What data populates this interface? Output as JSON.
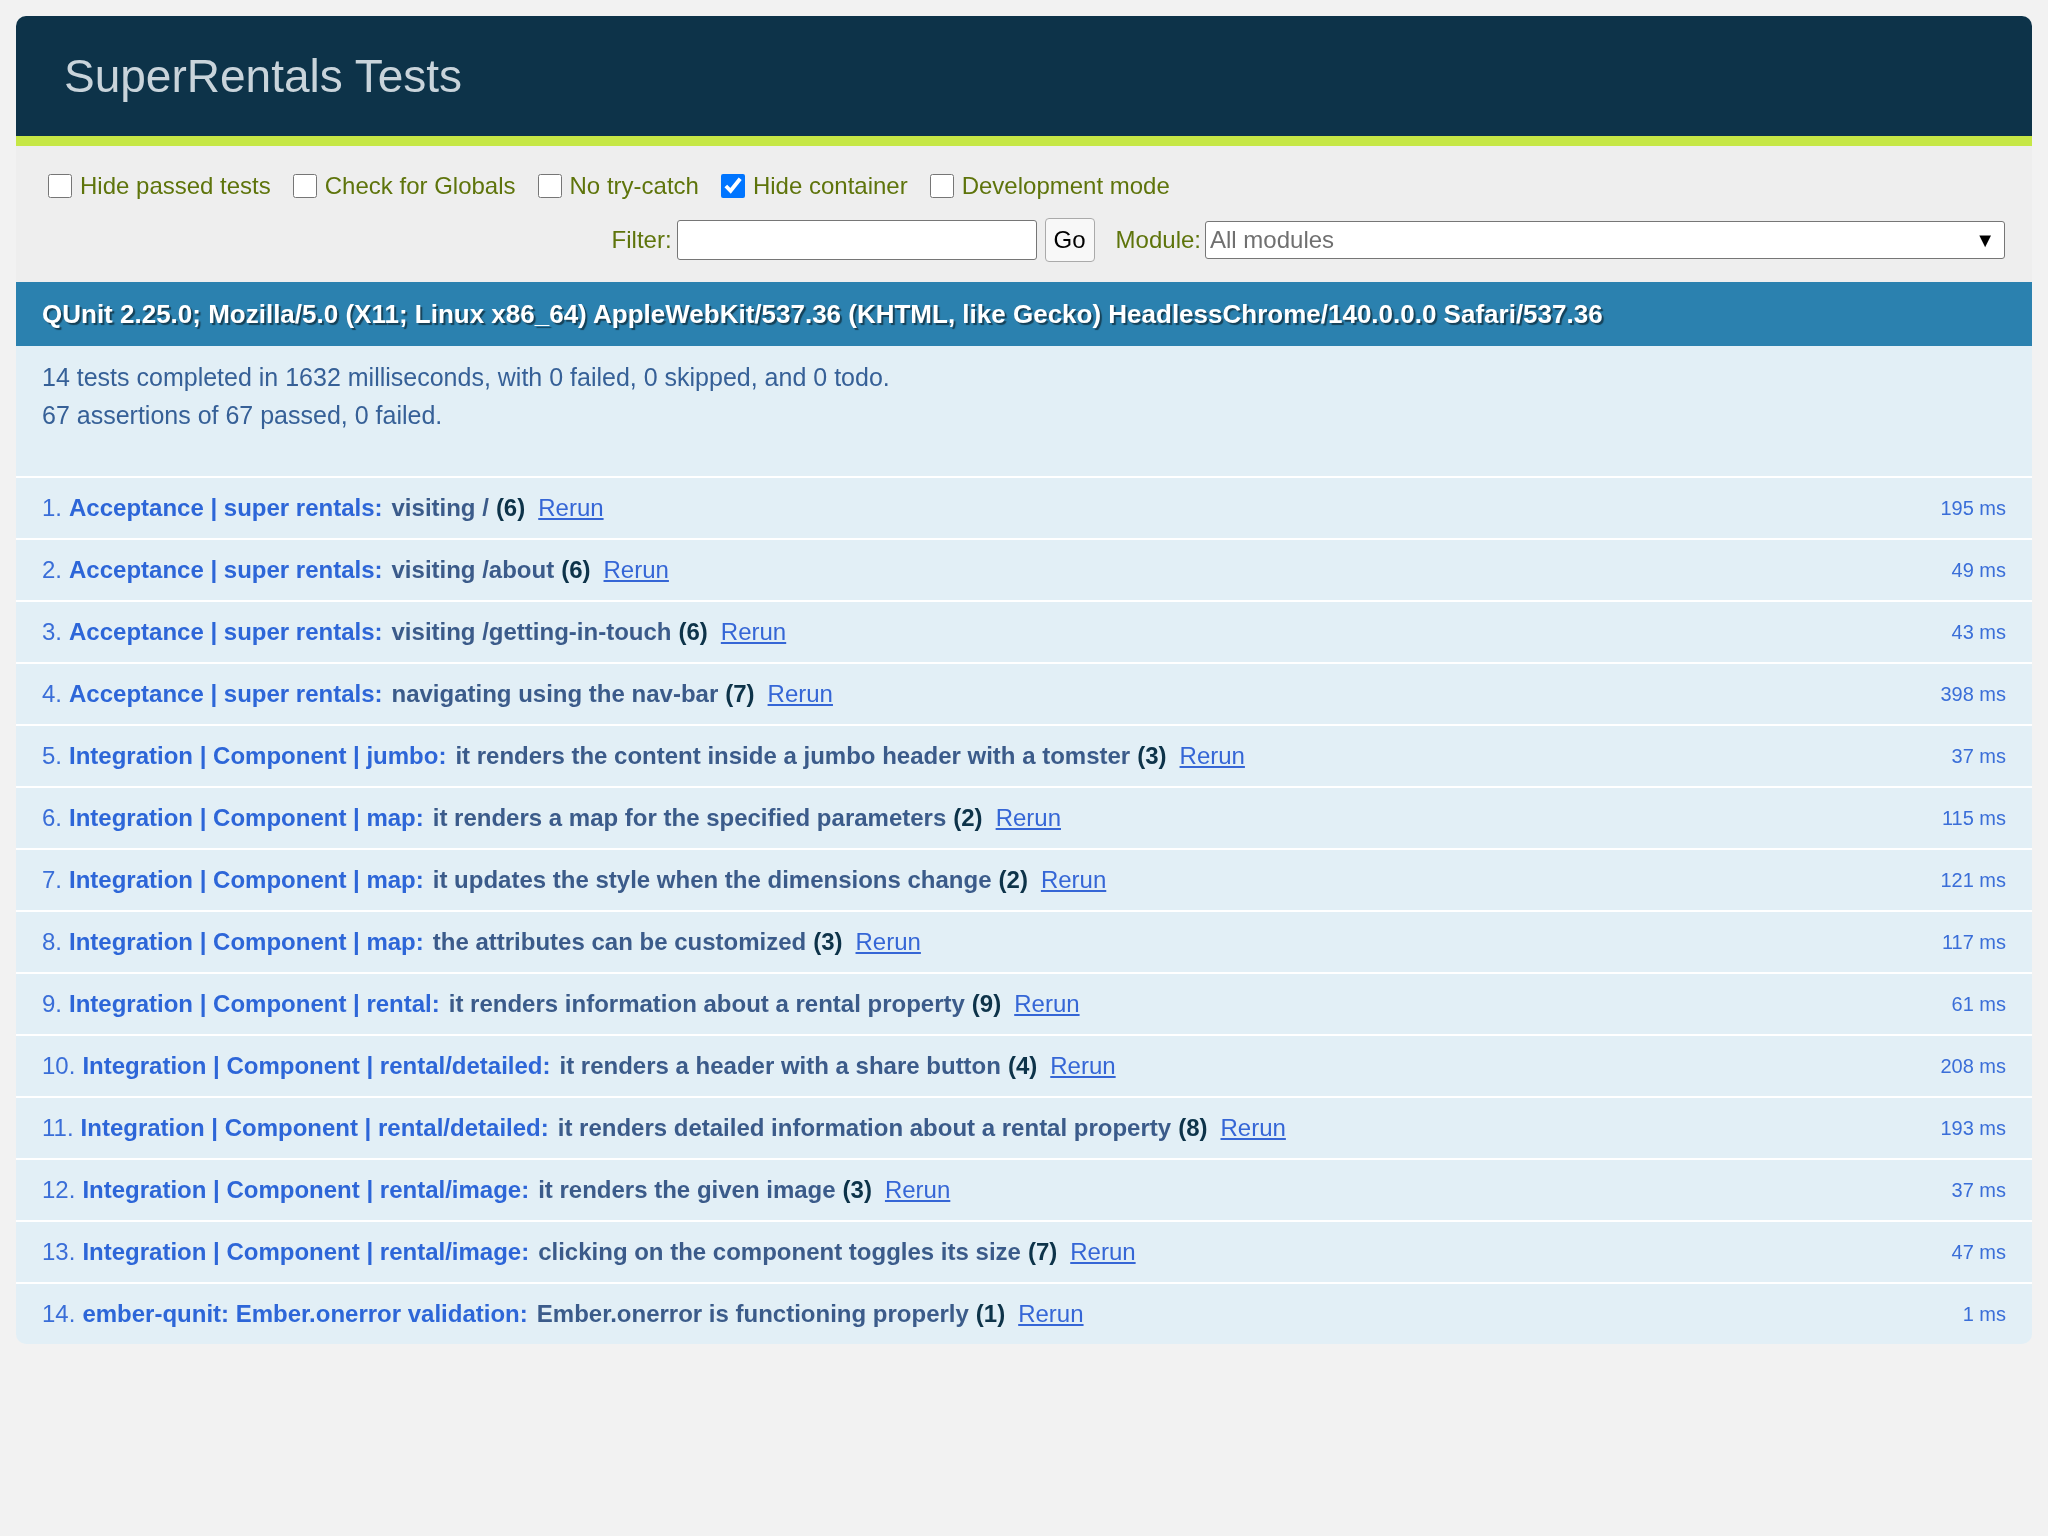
{
  "header": {
    "title": "SuperRentals Tests"
  },
  "toolbar": {
    "options": [
      {
        "label": "Hide passed tests",
        "checked": false
      },
      {
        "label": "Check for Globals",
        "checked": false
      },
      {
        "label": "No try-catch",
        "checked": false
      },
      {
        "label": "Hide container",
        "checked": true
      },
      {
        "label": "Development mode",
        "checked": false
      }
    ],
    "filter": {
      "label": "Filter:",
      "button": "Go"
    },
    "module": {
      "label": "Module:",
      "placeholder": "All modules",
      "arrow": "▼"
    }
  },
  "user_agent": "QUnit 2.25.0; Mozilla/5.0 (X11; Linux x86_64) AppleWebKit/537.36 (KHTML, like Gecko) HeadlessChrome/140.0.0.0 Safari/537.36",
  "summary": [
    "14 tests completed in 1632 milliseconds, with 0 failed, 0 skipped, and 0 todo.",
    "67 assertions of 67 passed, 0 failed."
  ],
  "tests": [
    {
      "number": "1.",
      "module": "Acceptance | super rentals:",
      "name": "visiting /",
      "count": "(6)",
      "action": "Rerun",
      "runtime": "195 ms"
    },
    {
      "number": "2.",
      "module": "Acceptance | super rentals:",
      "name": "visiting /about",
      "count": "(6)",
      "action": "Rerun",
      "runtime": "49 ms"
    },
    {
      "number": "3.",
      "module": "Acceptance | super rentals:",
      "name": "visiting /getting-in-touch",
      "count": "(6)",
      "action": "Rerun",
      "runtime": "43 ms"
    },
    {
      "number": "4.",
      "module": "Acceptance | super rentals:",
      "name": "navigating using the nav-bar",
      "count": "(7)",
      "action": "Rerun",
      "runtime": "398 ms"
    },
    {
      "number": "5.",
      "module": "Integration | Component | jumbo:",
      "name": "it renders the content inside a jumbo header with a tomster",
      "count": "(3)",
      "action": "Rerun",
      "runtime": "37 ms"
    },
    {
      "number": "6.",
      "module": "Integration | Component | map:",
      "name": "it renders a map for the specified parameters",
      "count": "(2)",
      "action": "Rerun",
      "runtime": "115 ms"
    },
    {
      "number": "7.",
      "module": "Integration | Component | map:",
      "name": "it updates the style when the dimensions change",
      "count": "(2)",
      "action": "Rerun",
      "runtime": "121 ms"
    },
    {
      "number": "8.",
      "module": "Integration | Component | map:",
      "name": "the attributes can be customized",
      "count": "(3)",
      "action": "Rerun",
      "runtime": "117 ms"
    },
    {
      "number": "9.",
      "module": "Integration | Component | rental:",
      "name": "it renders information about a rental property",
      "count": "(9)",
      "action": "Rerun",
      "runtime": "61 ms"
    },
    {
      "number": "10.",
      "module": "Integration | Component | rental/detailed:",
      "name": "it renders a header with a share button",
      "count": "(4)",
      "action": "Rerun",
      "runtime": "208 ms"
    },
    {
      "number": "11.",
      "module": "Integration | Component | rental/detailed:",
      "name": "it renders detailed information about a rental property",
      "count": "(8)",
      "action": "Rerun",
      "runtime": "193 ms"
    },
    {
      "number": "12.",
      "module": "Integration | Component | rental/image:",
      "name": "it renders the given image",
      "count": "(3)",
      "action": "Rerun",
      "runtime": "37 ms"
    },
    {
      "number": "13.",
      "module": "Integration | Component | rental/image:",
      "name": "clicking on the component toggles its size",
      "count": "(7)",
      "action": "Rerun",
      "runtime": "47 ms"
    },
    {
      "number": "14.",
      "module": "ember-qunit: Ember.onerror validation:",
      "name": "Ember.onerror is functioning properly",
      "count": "(1)",
      "action": "Rerun",
      "runtime": "1 ms"
    }
  ]
}
